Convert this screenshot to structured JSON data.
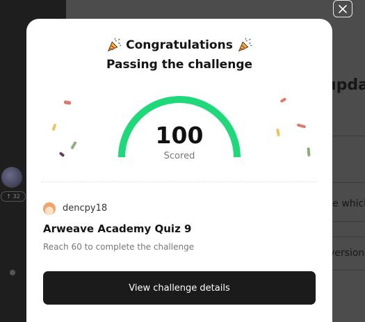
{
  "background": {
    "update_fragment": "upda",
    "row2_fragment": "ve which",
    "row3_fragment": "version",
    "badge": "↑ 32"
  },
  "modal": {
    "title": "Congratulations",
    "subtitle": "Passing the challenge",
    "score": "100",
    "score_label": "Scored",
    "score_fraction": 1.0,
    "username": "dencpy18",
    "quiz_title": "Arweave Academy Quiz 9",
    "quiz_description": "Reach 60 to complete the challenge",
    "cta_label": "View challenge details",
    "icons": {
      "title_left": "party-popper-icon",
      "title_right": "party-popper-icon",
      "close": "close-icon"
    },
    "colors": {
      "gauge": "#1fd87a",
      "button": "#1b1b1b",
      "confetti_red": "#e0776b",
      "confetti_yellow": "#f0c35a",
      "confetti_green": "#8ab07a",
      "confetti_purple": "#6b3a5e"
    }
  }
}
